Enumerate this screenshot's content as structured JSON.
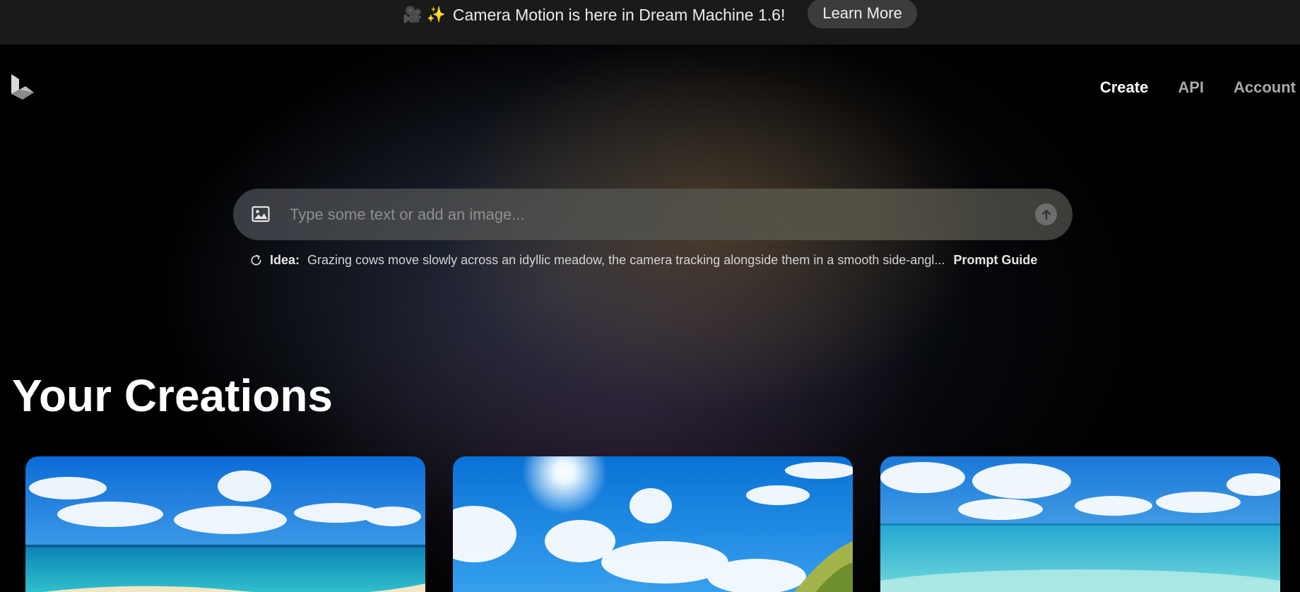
{
  "banner": {
    "emoji": "🎥 ✨",
    "text": "Camera Motion is here in Dream Machine 1.6!",
    "button_label": "Learn More"
  },
  "logo": {
    "icon": "luma-logo-icon"
  },
  "nav": {
    "items": [
      {
        "label": "Create",
        "active": true
      },
      {
        "label": "API",
        "active": false
      },
      {
        "label": "Account",
        "active": false
      }
    ]
  },
  "prompt": {
    "placeholder": "Type some text or add an image...",
    "value": "",
    "image_icon": "image-icon",
    "submit_icon": "arrow-up-icon"
  },
  "idea": {
    "refresh_icon": "refresh-icon",
    "label": "Idea:",
    "text": "Grazing cows move slowly across an idyllic meadow, the camera tracking alongside them in a smooth side-angl...",
    "guide_label": "Prompt Guide"
  },
  "creations": {
    "title": "Your Creations",
    "cards": [
      {
        "image": "beach-scene-thumbnail"
      },
      {
        "image": "sky-and-coast-thumbnail"
      },
      {
        "image": "ocean-horizon-thumbnail"
      }
    ]
  },
  "colors": {
    "banner_bg": "#1a1a1a",
    "button_bg": "#3c3c3c",
    "page_bg": "#000000",
    "nav_active": "#ffffff",
    "nav_inactive": "#a9a9a9"
  }
}
